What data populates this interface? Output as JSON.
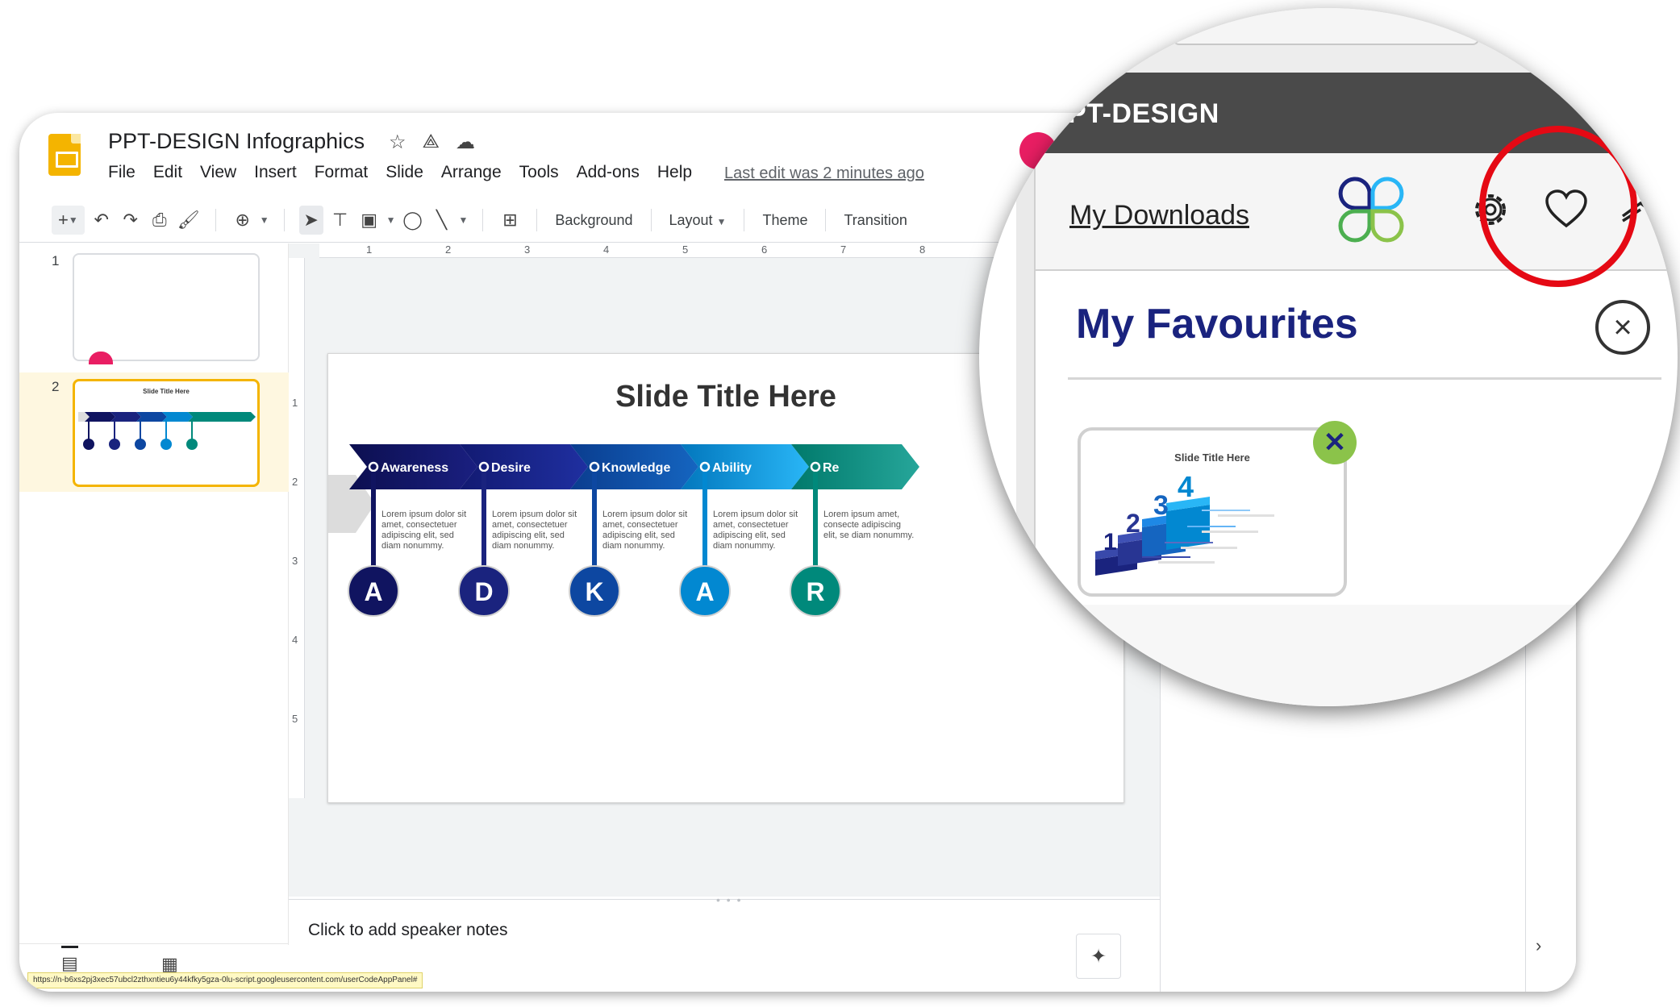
{
  "app": {
    "doc_title": "PPT-DESIGN Infographics",
    "last_edit": "Last edit was 2 minutes ago",
    "menu": [
      "File",
      "Edit",
      "View",
      "Insert",
      "Format",
      "Slide",
      "Arrange",
      "Tools",
      "Add-ons",
      "Help"
    ]
  },
  "toolbar": {
    "background": "Background",
    "layout": "Layout",
    "theme": "Theme",
    "transition": "Transition"
  },
  "ruler": {
    "h": [
      "1",
      "2",
      "3",
      "4",
      "5",
      "6",
      "7",
      "8"
    ],
    "v": [
      "1",
      "2",
      "3",
      "4",
      "5"
    ]
  },
  "filmstrip": {
    "slides": [
      "1",
      "2"
    ],
    "thumb2_title": "Slide Title Here"
  },
  "slide": {
    "title": "Slide Title Here",
    "steps": [
      {
        "label": "Awareness",
        "letter": "A",
        "text": "Lorem ipsum dolor sit amet, consectetuer adipiscing elit, sed diam nonummy.",
        "color": "#101460"
      },
      {
        "label": "Desire",
        "letter": "D",
        "text": "Lorem ipsum dolor sit amet, consectetuer adipiscing elit, sed diam nonummy.",
        "color": "#1a237e"
      },
      {
        "label": "Knowledge",
        "letter": "K",
        "text": "Lorem ipsum dolor sit amet, consectetuer adipiscing elit, sed diam nonummy.",
        "color": "#0d47a1"
      },
      {
        "label": "Ability",
        "letter": "A",
        "text": "Lorem ipsum dolor sit amet, consectetuer adipiscing elit, sed diam nonummy.",
        "color": "#0288d1"
      },
      {
        "label": "Re",
        "letter": "R",
        "text": "Lorem ipsum amet, consecte adipiscing elit, se diam nonummy.",
        "color": "#00897b"
      }
    ]
  },
  "notes": {
    "placeholder": "Click to add speaker notes"
  },
  "status_url": "https://n-b6xs2pj3xec57ubcl2zthxntieu6y44kfky5gza-0lu-script.googleusercontent.com/userCodeAppPanel#",
  "magnifier": {
    "brand": "PT-DESIGN",
    "my_downloads": "My Downloads",
    "favourites_title": "My Favourites",
    "favourite_card_title": "Slide Title Here",
    "close_icon": "close-icon",
    "remove_icon": "x-icon",
    "highlight_color": "#e50914",
    "title_color": "#1a237e"
  }
}
